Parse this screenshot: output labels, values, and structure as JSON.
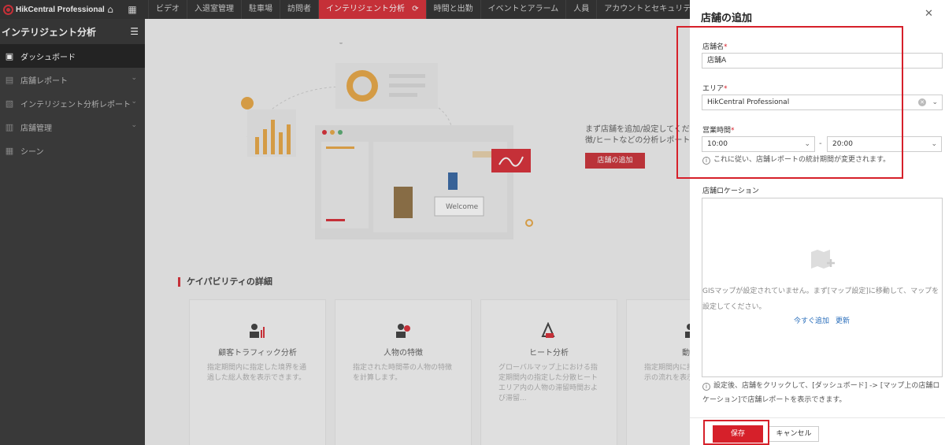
{
  "app": {
    "title": "HikCentral Professional"
  },
  "top_nav": {
    "items": [
      {
        "label": "ビデオ"
      },
      {
        "label": "入退室管理"
      },
      {
        "label": "駐車場"
      },
      {
        "label": "訪問者"
      },
      {
        "label": "インテリジェント分析",
        "active": true
      },
      {
        "label": "時間と出勤"
      },
      {
        "label": "イベントとアラーム"
      },
      {
        "label": "人員"
      },
      {
        "label": "アカウントとセキュリティ"
      }
    ]
  },
  "sidebar": {
    "title": "インテリジェント分析",
    "items": [
      {
        "label": "ダッシュボード",
        "icon": "dashboard-icon",
        "active": true
      },
      {
        "label": "店舗レポート",
        "icon": "store-report-icon",
        "expandable": true
      },
      {
        "label": "インテリジェント分析レポート",
        "icon": "analysis-report-icon",
        "expandable": true
      },
      {
        "label": "店舗管理",
        "icon": "store-icon",
        "expandable": true
      },
      {
        "label": "シーン",
        "icon": "scene-icon"
      }
    ]
  },
  "main": {
    "intro_text_1": "まず店舗を追加/設定してください",
    "intro_text_2": "徴/ヒートなどの分析レポートを表",
    "add_store_button": "店舗の追加",
    "illustration_welcome": "Welcome",
    "capability_title": "ケイパビリティの詳細",
    "cards": [
      {
        "title": "顧客トラフィック分析",
        "desc": "指定期間内に指定した境界を通過した総人数を表示できます。"
      },
      {
        "title": "人物の特徴",
        "desc": "指定された時間帯の人物の特徴を計算します。"
      },
      {
        "title": "ヒート分析",
        "desc": "グローバルマップ上における指定期間内の指定した分散ヒートエリア内の人物の滞留時間および滞留..."
      },
      {
        "title": "動",
        "desc": "指定期間内に指定した人数を表示の流れを表示"
      }
    ]
  },
  "drawer": {
    "title": "店舗の追加",
    "store_name_label": "店舗名",
    "store_name_value": "店舗A",
    "area_label": "エリア",
    "area_value": "HikCentral Professional",
    "hours_label": "営業時間",
    "hours_start": "10:00",
    "hours_end": "20:00",
    "hours_separator": "-",
    "hours_hint": "これに従い、店舗レポートの統計期間が変更されます。",
    "location_label": "店舗ロケーション",
    "map_message": "GISマップが設定されていません。まず[マップ設定]に移動して、マップを設定してください。",
    "add_now_link": "今すぐ追加",
    "refresh_link": "更新",
    "location_hint": "設定後、店舗をクリックして、[ダッシュボード] -> [マップ上の店舗ロケーション]で店舗レポートを表示できます。",
    "save_button": "保存",
    "cancel_button": "キャンセル"
  },
  "colors": {
    "accent": "#d6202a",
    "topbar": "#212121",
    "sidebar": "#2b2b2b",
    "link": "#2a6ebb"
  }
}
